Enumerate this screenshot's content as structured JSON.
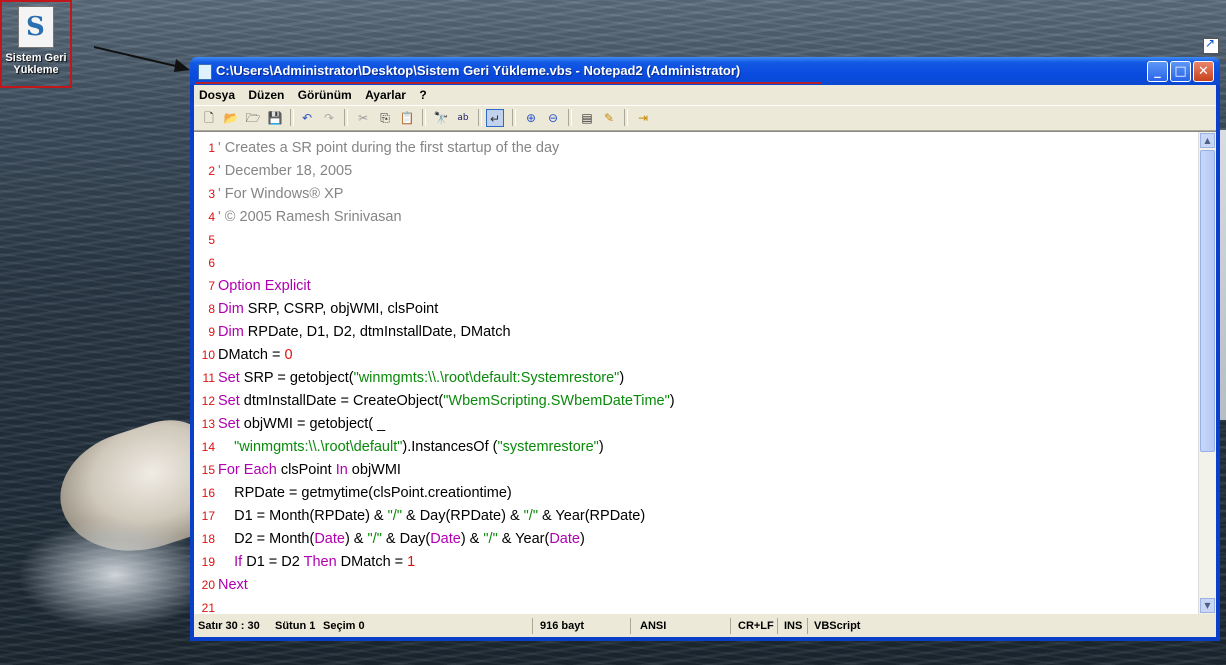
{
  "desktop": {
    "icon_label_line1": "Sistem Geri",
    "icon_label_line2": "Yükleme"
  },
  "window": {
    "title": "C:\\Users\\Administrator\\Desktop\\Sistem Geri Yükleme.vbs - Notepad2 (Administrator)",
    "menu": [
      "Dosya",
      "Düzen",
      "Görünüm",
      "Ayarlar",
      "?"
    ]
  },
  "editor": {
    "lines": [
      {
        "n": "1",
        "parts": [
          {
            "c": "cm",
            "t": "' Creates a SR point during the first startup of the day"
          }
        ]
      },
      {
        "n": "2",
        "parts": [
          {
            "c": "cm",
            "t": "' December 18, 2005"
          }
        ]
      },
      {
        "n": "3",
        "parts": [
          {
            "c": "cm",
            "t": "' For Windows® XP"
          }
        ]
      },
      {
        "n": "4",
        "parts": [
          {
            "c": "cm",
            "t": "' © 2005 Ramesh Srinivasan"
          }
        ]
      },
      {
        "n": "5",
        "parts": []
      },
      {
        "n": "6",
        "parts": []
      },
      {
        "n": "7",
        "parts": [
          {
            "c": "kw",
            "t": "Option Explicit"
          }
        ]
      },
      {
        "n": "8",
        "parts": [
          {
            "c": "kw",
            "t": "Dim"
          },
          {
            "c": "",
            "t": " SRP, CSRP, objWMI, clsPoint"
          }
        ]
      },
      {
        "n": "9",
        "parts": [
          {
            "c": "kw",
            "t": "Dim"
          },
          {
            "c": "",
            "t": " RPDate, D1, D2, dtmInstallDate, DMatch"
          }
        ]
      },
      {
        "n": "10",
        "parts": [
          {
            "c": "",
            "t": "DMatch = "
          },
          {
            "c": "nm",
            "t": "0"
          }
        ]
      },
      {
        "n": "11",
        "parts": [
          {
            "c": "kw",
            "t": "Set"
          },
          {
            "c": "",
            "t": " SRP = getobject("
          },
          {
            "c": "st",
            "t": "\"winmgmts:\\\\.\\root\\default:Systemrestore\""
          },
          {
            "c": "",
            "t": ")"
          }
        ]
      },
      {
        "n": "12",
        "parts": [
          {
            "c": "kw",
            "t": "Set"
          },
          {
            "c": "",
            "t": " dtmInstallDate = CreateObject("
          },
          {
            "c": "st",
            "t": "\"WbemScripting.SWbemDateTime\""
          },
          {
            "c": "",
            "t": ")"
          }
        ]
      },
      {
        "n": "13",
        "parts": [
          {
            "c": "kw",
            "t": "Set"
          },
          {
            "c": "",
            "t": " objWMI = getobject( _"
          }
        ]
      },
      {
        "n": "14",
        "parts": [
          {
            "c": "",
            "t": "    "
          },
          {
            "c": "st",
            "t": "\"winmgmts:\\\\.\\root\\default\""
          },
          {
            "c": "",
            "t": ").InstancesOf ("
          },
          {
            "c": "st",
            "t": "\"systemrestore\""
          },
          {
            "c": "",
            "t": ")"
          }
        ]
      },
      {
        "n": "15",
        "parts": [
          {
            "c": "kw",
            "t": "For Each"
          },
          {
            "c": "",
            "t": " clsPoint "
          },
          {
            "c": "kw",
            "t": "In"
          },
          {
            "c": "",
            "t": " objWMI"
          }
        ]
      },
      {
        "n": "16",
        "parts": [
          {
            "c": "",
            "t": "    RPDate = getmytime(clsPoint.creationtime)"
          }
        ]
      },
      {
        "n": "17",
        "parts": [
          {
            "c": "",
            "t": "    D1 = Month(RPDate) & "
          },
          {
            "c": "st",
            "t": "\"/\""
          },
          {
            "c": "",
            "t": " & Day(RPDate) & "
          },
          {
            "c": "st",
            "t": "\"/\""
          },
          {
            "c": "",
            "t": " & Year(RPDate)"
          }
        ]
      },
      {
        "n": "18",
        "parts": [
          {
            "c": "",
            "t": "    D2 = Month("
          },
          {
            "c": "kw",
            "t": "Date"
          },
          {
            "c": "",
            "t": ") & "
          },
          {
            "c": "st",
            "t": "\"/\""
          },
          {
            "c": "",
            "t": " & Day("
          },
          {
            "c": "kw",
            "t": "Date"
          },
          {
            "c": "",
            "t": ") & "
          },
          {
            "c": "st",
            "t": "\"/\""
          },
          {
            "c": "",
            "t": " & Year("
          },
          {
            "c": "kw",
            "t": "Date"
          },
          {
            "c": "",
            "t": ")"
          }
        ]
      },
      {
        "n": "19",
        "parts": [
          {
            "c": "",
            "t": "    "
          },
          {
            "c": "kw",
            "t": "If"
          },
          {
            "c": "",
            "t": " D1 = D2 "
          },
          {
            "c": "kw",
            "t": "Then"
          },
          {
            "c": "",
            "t": " DMatch = "
          },
          {
            "c": "nm",
            "t": "1"
          }
        ]
      },
      {
        "n": "20",
        "parts": [
          {
            "c": "kw",
            "t": "Next"
          }
        ]
      },
      {
        "n": "21",
        "parts": []
      }
    ]
  },
  "status": {
    "position": "Satır 30 : 30",
    "column": "Sütun 1",
    "selection": "Seçim 0",
    "size": "916 bayt",
    "encoding": "ANSI",
    "line_ending": "CR+LF",
    "insert_mode": "INS",
    "language": "VBScript"
  },
  "colors": {
    "comment": "#858585",
    "keyword": "#b000b0",
    "string": "#0a8a0a",
    "number": "#e01010",
    "line_number": "#dd1111",
    "titlebar": "#0a4be0"
  }
}
